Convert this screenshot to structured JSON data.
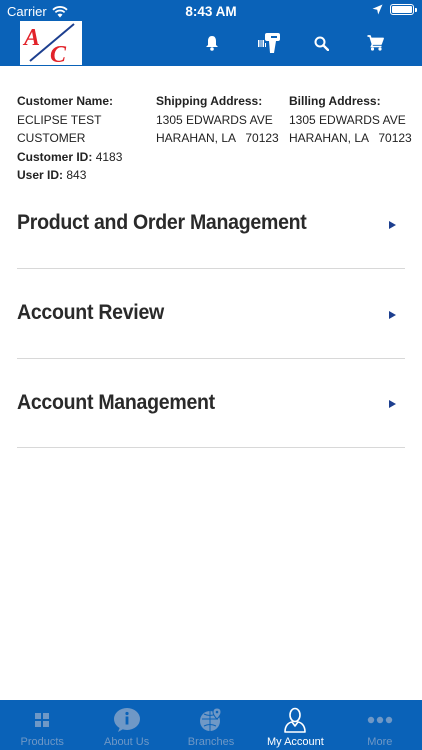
{
  "status_bar": {
    "carrier": "Carrier",
    "time": "8:43 AM"
  },
  "header": {
    "logo_text": "A/C",
    "icons": [
      "bell-icon",
      "barcode-scanner-icon",
      "search-icon",
      "cart-icon"
    ]
  },
  "customer": {
    "name_label": "Customer Name:",
    "name_line1": "ECLIPSE TEST",
    "name_line2": "CUSTOMER",
    "customer_id_label": "Customer ID:",
    "customer_id": "4183",
    "user_id_label": "User ID:",
    "user_id": "843"
  },
  "shipping": {
    "label": "Shipping Address:",
    "line1": "1305 EDWARDS AVE",
    "line2": "HARAHAN, LA   70123"
  },
  "billing": {
    "label": "Billing Address:",
    "line1": "1305 EDWARDS AVE",
    "line2": "HARAHAN, LA   70123"
  },
  "menu": [
    {
      "label": "Product and Order Management"
    },
    {
      "label": "Account Review"
    },
    {
      "label": "Account Management"
    }
  ],
  "tabs": [
    {
      "label": "Products",
      "icon": "grid-icon",
      "active": false
    },
    {
      "label": "About Us",
      "icon": "info-icon",
      "active": false
    },
    {
      "label": "Branches",
      "icon": "globe-pin-icon",
      "active": false
    },
    {
      "label": "My Account",
      "icon": "person-icon",
      "active": true
    },
    {
      "label": "More",
      "icon": "more-dots-icon",
      "active": false
    }
  ],
  "colors": {
    "brand_blue": "#0a62b8",
    "arrow_blue": "#1d3f8f",
    "tab_inactive": "#6f98c6",
    "logo_red": "#e2232a"
  }
}
